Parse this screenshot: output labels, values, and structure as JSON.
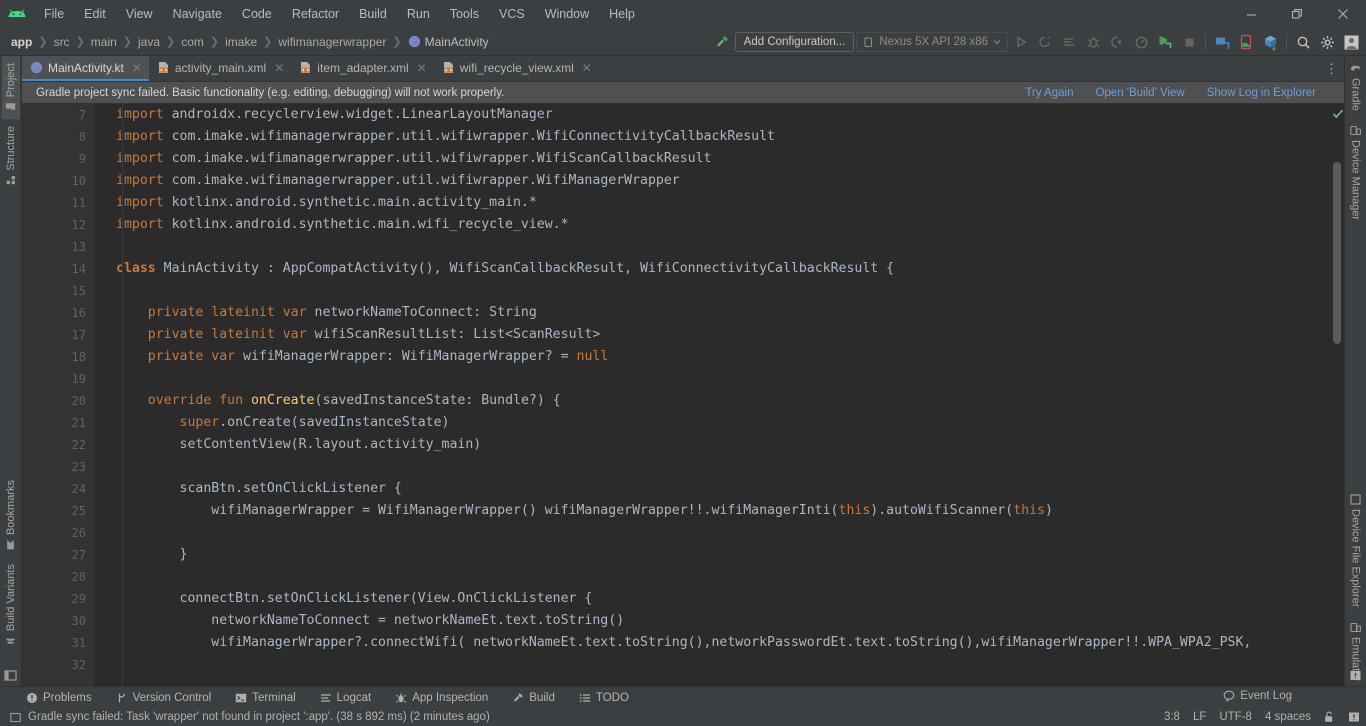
{
  "window": {
    "minimize_label": "Minimize",
    "restore_label": "Restore",
    "close_label": "Close"
  },
  "menu": {
    "items": [
      {
        "label": "File"
      },
      {
        "label": "Edit"
      },
      {
        "label": "View"
      },
      {
        "label": "Navigate"
      },
      {
        "label": "Code"
      },
      {
        "label": "Refactor"
      },
      {
        "label": "Build"
      },
      {
        "label": "Run"
      },
      {
        "label": "Tools"
      },
      {
        "label": "VCS"
      },
      {
        "label": "Window"
      },
      {
        "label": "Help"
      }
    ]
  },
  "breadcrumb": {
    "items": [
      "app",
      "src",
      "main",
      "java",
      "com",
      "imake",
      "wifimanagerwrapper",
      "MainActivity"
    ]
  },
  "toolbar": {
    "add_configuration_label": "Add Configuration...",
    "device_label": "Nexus 5X API 28 x86",
    "icons": [
      "run-icon",
      "rerun-icon",
      "apply-changes-icon",
      "debug-icon",
      "attach-debugger-icon",
      "profiler-icon",
      "apply-code-changes-icon",
      "stop-icon",
      "avd-manager-icon",
      "sdk-manager-icon",
      "gradle-sync-icon",
      "search-icon",
      "settings-gear-icon",
      "user-avatar-icon"
    ],
    "build_hammer_icon": "build-hammer-icon"
  },
  "tabs": {
    "items": [
      {
        "label": "MainActivity.kt",
        "icon": "kotlin-file-icon",
        "active": true
      },
      {
        "label": "activity_main.xml",
        "icon": "xml-layout-file-icon",
        "active": false
      },
      {
        "label": "item_adapter.xml",
        "icon": "xml-layout-file-icon",
        "active": false
      },
      {
        "label": "wifi_recycle_view.xml",
        "icon": "xml-layout-file-icon",
        "active": false
      }
    ],
    "close_glyph": "✕",
    "overflow_glyph": "⋮"
  },
  "banner": {
    "message": "Gradle project sync failed. Basic functionality (e.g. editing, debugging) will not work properly.",
    "links": [
      "Try Again",
      "Open 'Build' View",
      "Show Log in Explorer"
    ]
  },
  "editor": {
    "first_line_number": 7,
    "lines": [
      {
        "n": 7,
        "fold": "",
        "tokens": [
          {
            "t": "import ",
            "c": "kw"
          },
          {
            "t": "androidx.recyclerview.widget.LinearLayoutManager",
            "c": "id"
          }
        ]
      },
      {
        "n": 8,
        "fold": "",
        "tokens": [
          {
            "t": "import ",
            "c": "kw"
          },
          {
            "t": "com.imake.wifimanagerwrapper.util.wifiwrapper.WifiConnectivityCallbackResult",
            "c": "id"
          }
        ]
      },
      {
        "n": 9,
        "fold": "",
        "tokens": [
          {
            "t": "import ",
            "c": "kw"
          },
          {
            "t": "com.imake.wifimanagerwrapper.util.wifiwrapper.WifiScanCallbackResult",
            "c": "id"
          }
        ]
      },
      {
        "n": 10,
        "fold": "",
        "tokens": [
          {
            "t": "import ",
            "c": "kw"
          },
          {
            "t": "com.imake.wifimanagerwrapper.util.wifiwrapper.WifiManagerWrapper",
            "c": "id"
          }
        ]
      },
      {
        "n": 11,
        "fold": "",
        "tokens": [
          {
            "t": "import ",
            "c": "kw"
          },
          {
            "t": "kotlinx.android.synthetic.main.activity_main.*",
            "c": "id"
          }
        ]
      },
      {
        "n": 12,
        "fold": "minus",
        "tokens": [
          {
            "t": "import ",
            "c": "kw"
          },
          {
            "t": "kotlinx.android.synthetic.main.wifi_recycle_view.*",
            "c": "id"
          }
        ]
      },
      {
        "n": 13,
        "fold": "",
        "tokens": []
      },
      {
        "n": 14,
        "fold": "minus",
        "tokens": [
          {
            "t": "class ",
            "c": "kwb"
          },
          {
            "t": "MainActivity",
            "c": "id"
          },
          {
            "t": " : ",
            "c": "id"
          },
          {
            "t": "AppCompatActivity(), WifiScanCallbackResult, WifiConnectivityCallbackResult {",
            "c": "id"
          }
        ]
      },
      {
        "n": 15,
        "fold": "",
        "tokens": []
      },
      {
        "n": 16,
        "fold": "",
        "tokens": [
          {
            "t": "    ",
            "c": "id"
          },
          {
            "t": "private lateinit var ",
            "c": "kw"
          },
          {
            "t": "networkNameToConnect: String",
            "c": "id"
          }
        ]
      },
      {
        "n": 17,
        "fold": "",
        "tokens": [
          {
            "t": "    ",
            "c": "id"
          },
          {
            "t": "private lateinit var ",
            "c": "kw"
          },
          {
            "t": "wifiScanResultList: List<ScanResult>",
            "c": "id"
          }
        ]
      },
      {
        "n": 18,
        "fold": "",
        "tokens": [
          {
            "t": "    ",
            "c": "id"
          },
          {
            "t": "private var ",
            "c": "kw"
          },
          {
            "t": "wifiManagerWrapper: WifiManagerWrapper? = ",
            "c": "id"
          },
          {
            "t": "null",
            "c": "kw"
          }
        ]
      },
      {
        "n": 19,
        "fold": "",
        "tokens": []
      },
      {
        "n": 20,
        "fold": "minus",
        "tokens": [
          {
            "t": "    ",
            "c": "id"
          },
          {
            "t": "override fun ",
            "c": "kw"
          },
          {
            "t": "onCreate",
            "c": "fn"
          },
          {
            "t": "(savedInstanceState: Bundle?) {",
            "c": "id"
          }
        ]
      },
      {
        "n": 21,
        "fold": "",
        "tokens": [
          {
            "t": "        ",
            "c": "id"
          },
          {
            "t": "super",
            "c": "kw"
          },
          {
            "t": ".onCreate(savedInstanceState)",
            "c": "id"
          }
        ]
      },
      {
        "n": 22,
        "fold": "",
        "tokens": [
          {
            "t": "        setContentView(R.layout.activity_main)",
            "c": "id"
          }
        ]
      },
      {
        "n": 23,
        "fold": "",
        "tokens": []
      },
      {
        "n": 24,
        "fold": "minus",
        "tokens": [
          {
            "t": "        scanBtn.setOnClickListener {",
            "c": "id"
          }
        ]
      },
      {
        "n": 25,
        "fold": "",
        "tokens": [
          {
            "t": "            wifiManagerWrapper = WifiManagerWrapper() wifiManagerWrapper!!.wifiManagerInti(",
            "c": "id"
          },
          {
            "t": "this",
            "c": "kw"
          },
          {
            "t": ").autoWifiScanner(",
            "c": "id"
          },
          {
            "t": "this",
            "c": "kw"
          },
          {
            "t": ")",
            "c": "id"
          }
        ]
      },
      {
        "n": 26,
        "fold": "",
        "tokens": []
      },
      {
        "n": 27,
        "fold": "minus",
        "tokens": [
          {
            "t": "        }",
            "c": "id"
          }
        ]
      },
      {
        "n": 28,
        "fold": "",
        "tokens": []
      },
      {
        "n": 29,
        "fold": "minus",
        "tokens": [
          {
            "t": "        connectBtn.setOnClickListener(View.OnClickListener {",
            "c": "id"
          }
        ]
      },
      {
        "n": 30,
        "fold": "",
        "tokens": [
          {
            "t": "            networkNameToConnect = networkNameEt.text.toString()",
            "c": "id"
          }
        ]
      },
      {
        "n": 31,
        "fold": "",
        "tokens": [
          {
            "t": "            wifiManagerWrapper?.connectWifi( networkNameEt.text.toString(),networkPasswordEt.text.toString(),wifiManagerWrapper!!.WPA_WPA2_PSK,",
            "c": "id"
          }
        ]
      },
      {
        "n": 32,
        "fold": "",
        "tokens": []
      }
    ],
    "inspection_status_icon": "ok-checkmark-icon"
  },
  "left_stripe": {
    "items": [
      {
        "label": "Project",
        "icon": "project-folder-icon"
      },
      {
        "label": "Structure",
        "icon": "structure-icon"
      },
      {
        "label": "Bookmarks",
        "icon": "bookmark-icon"
      },
      {
        "label": "Build Variants",
        "icon": "build-variants-icon"
      }
    ]
  },
  "right_stripe": {
    "items": [
      {
        "label": "Gradle",
        "icon": "gradle-elephant-icon"
      },
      {
        "label": "Device Manager",
        "icon": "device-manager-icon"
      },
      {
        "label": "Device File Explorer",
        "icon": "device-file-explorer-icon"
      },
      {
        "label": "Emulator",
        "icon": "emulator-icon"
      }
    ]
  },
  "bottom_bar": {
    "items": [
      {
        "label": "Problems",
        "icon": "problems-icon"
      },
      {
        "label": "Version Control",
        "icon": "version-control-branch-icon"
      },
      {
        "label": "Terminal",
        "icon": "terminal-icon"
      },
      {
        "label": "Logcat",
        "icon": "logcat-icon"
      },
      {
        "label": "App Inspection",
        "icon": "app-inspection-icon"
      },
      {
        "label": "Build",
        "icon": "build-hammer-icon"
      },
      {
        "label": "TODO",
        "icon": "todo-list-icon"
      }
    ]
  },
  "status_bar": {
    "message": "Gradle sync failed: Task 'wrapper' not found in project ':app'. (38 s 892 ms) (2 minutes ago)",
    "event_log_label": "Event Log",
    "caret_position": "3:8",
    "line_separator": "LF",
    "encoding": "UTF-8",
    "indent": "4 spaces",
    "lock_icon": "unlocked-padlock-icon",
    "notification_icon": "notification-bell-icon",
    "left_icon": "status-message-icon"
  },
  "colors": {
    "accent_blue": "#4a88c7",
    "keyword_orange": "#cc7832",
    "identifier": "#a9b7c6",
    "editor_bg": "#2b2b2b",
    "chrome_bg": "#3c3f41",
    "link_blue": "#6c9fd6",
    "android_green": "#3ddc84"
  }
}
